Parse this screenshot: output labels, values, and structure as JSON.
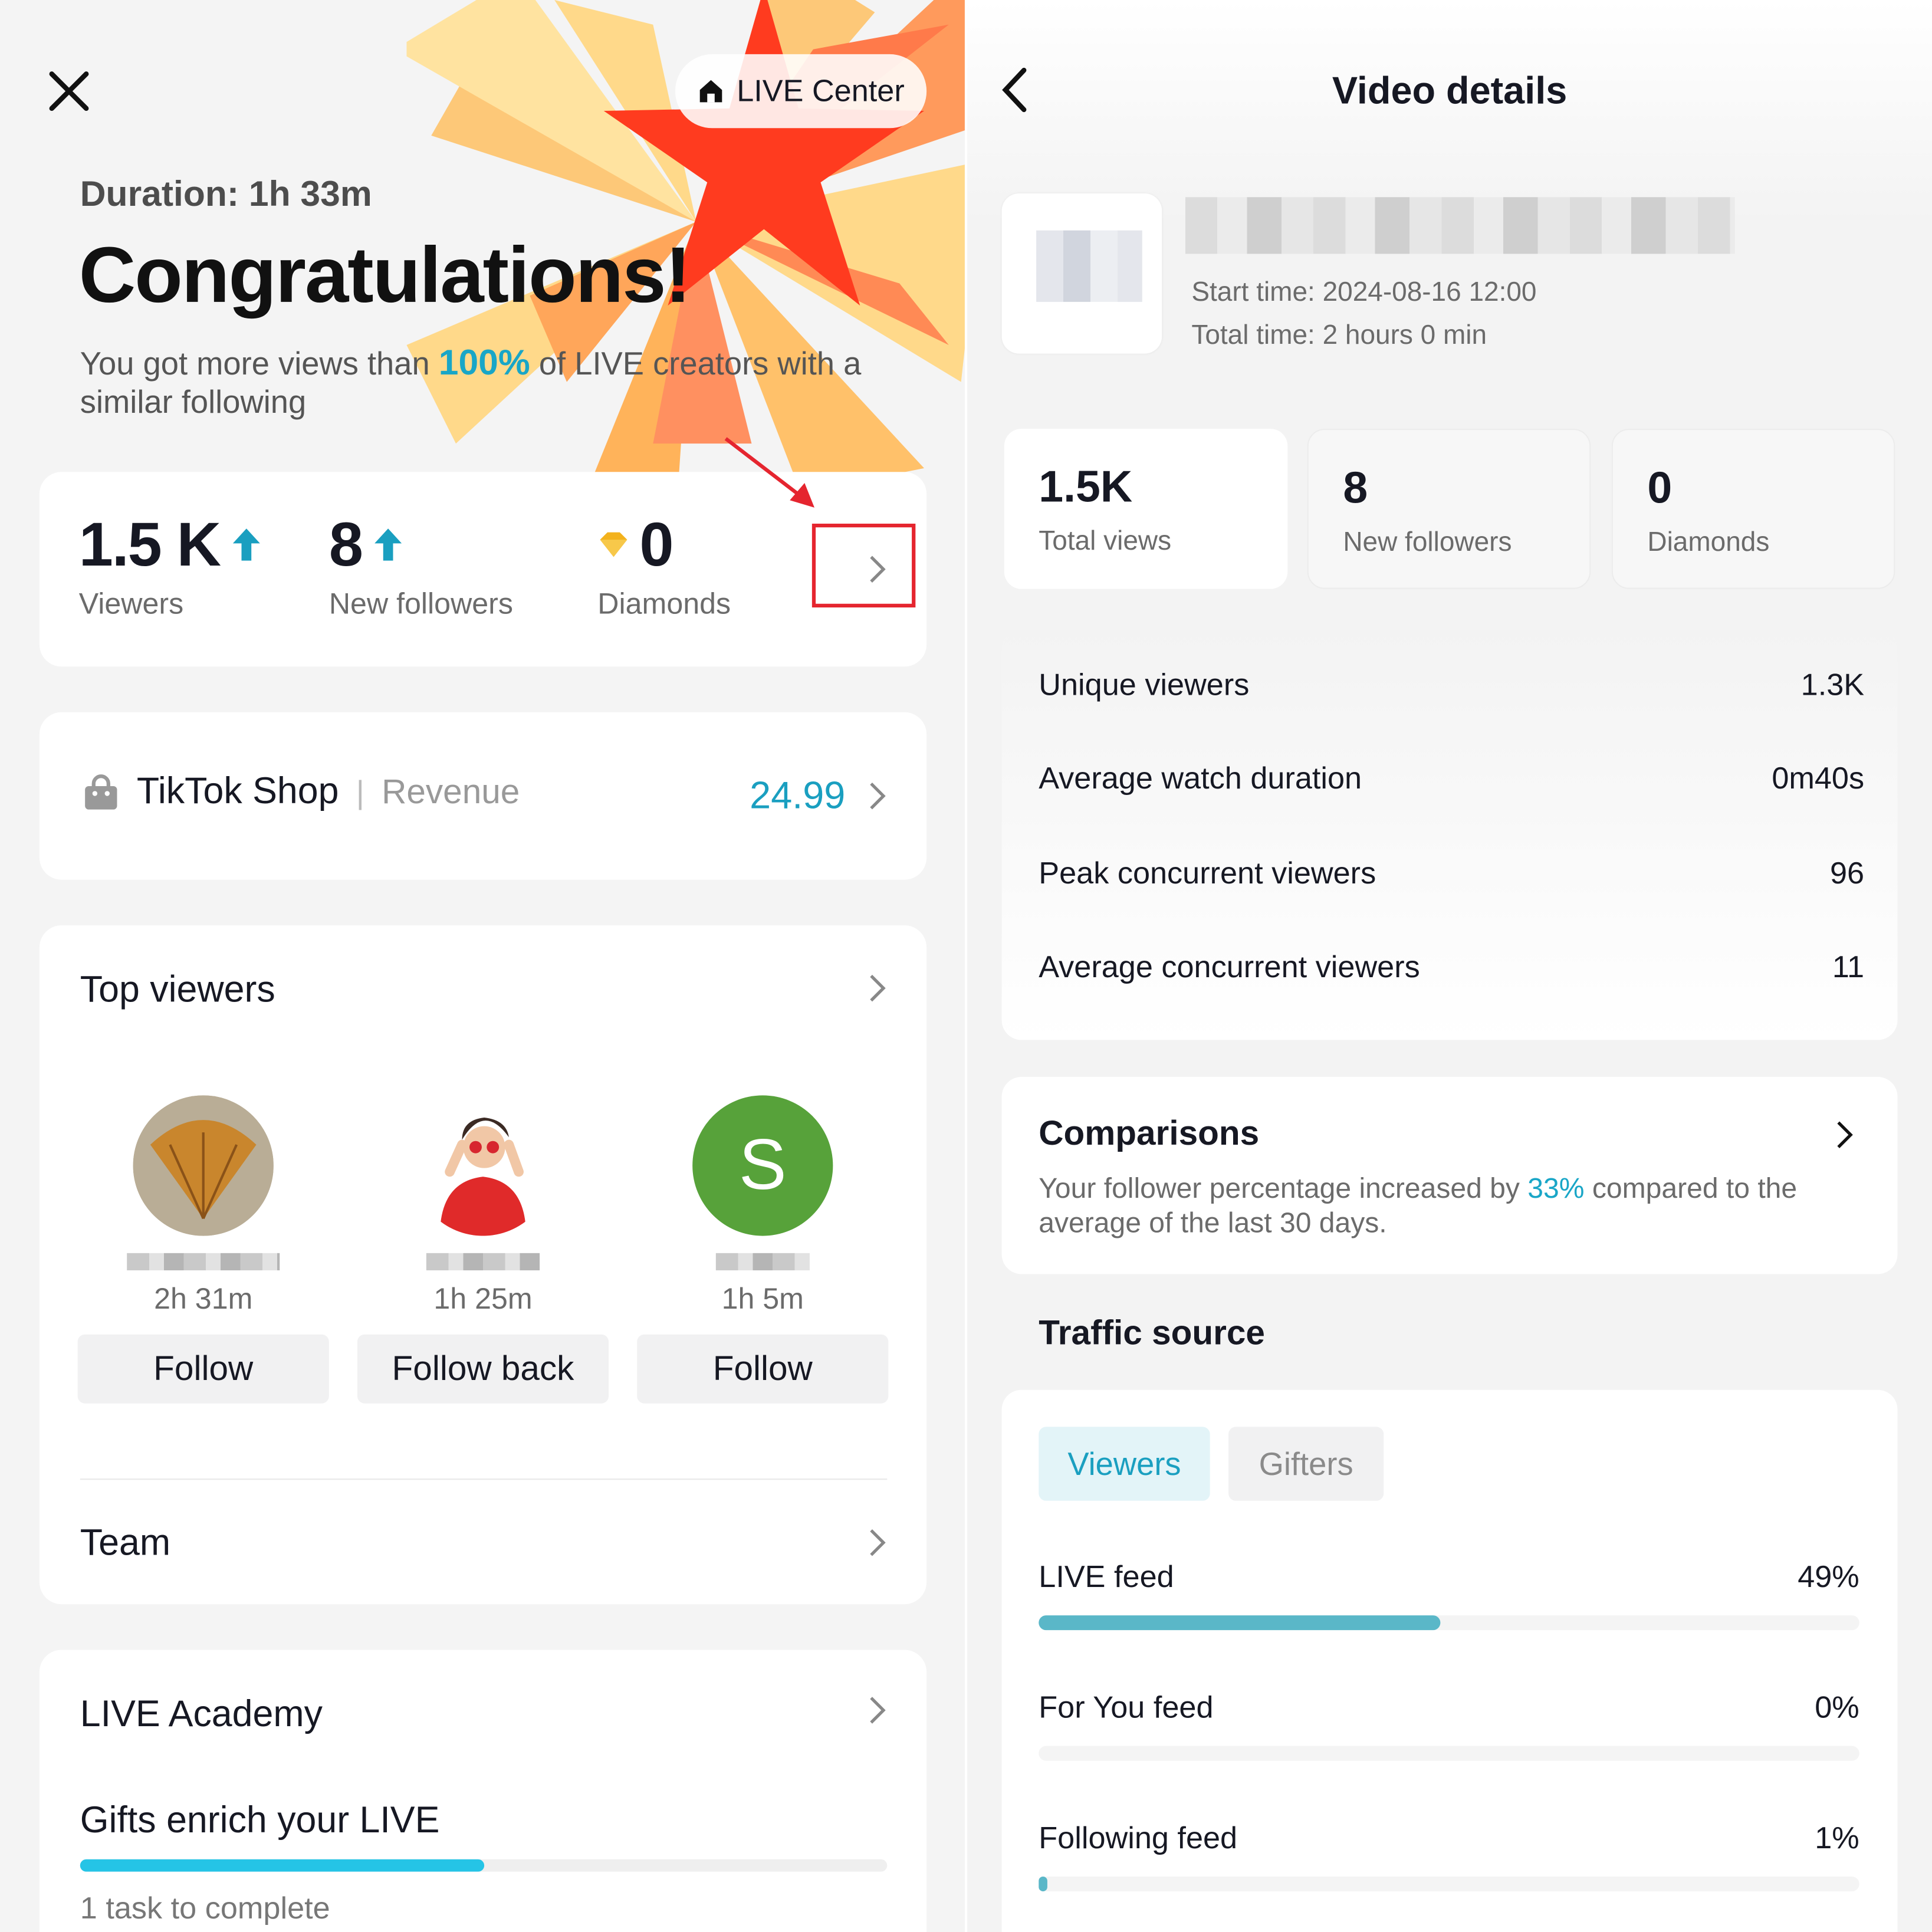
{
  "left": {
    "live_center_label": "LIVE Center",
    "duration": "Duration: 1h 33m",
    "headline": "Congratulations!",
    "views_prefix": "You got more views than ",
    "views_pct": "100%",
    "views_suffix": " of LIVE creators with a similar following",
    "stats": [
      {
        "value": "1.5 K",
        "label": "Viewers",
        "trend": "up"
      },
      {
        "value": "8",
        "label": "New followers",
        "trend": "up"
      },
      {
        "value": "0",
        "label": "Diamonds",
        "trend": "none"
      }
    ],
    "shop": {
      "title": "TikTok Shop",
      "separator": "|",
      "sub": "Revenue",
      "value": "24.99"
    },
    "top_viewers": {
      "title": "Top viewers",
      "viewers": [
        {
          "time": "2h 31m",
          "button": "Follow"
        },
        {
          "time": "1h 25m",
          "button": "Follow back"
        },
        {
          "time": "1h 5m",
          "button": "Follow",
          "initial": "S"
        }
      ]
    },
    "team_title": "Team",
    "academy": {
      "title": "LIVE Academy",
      "task": "Gifts enrich your LIVE",
      "progress": 0.5,
      "remaining": "1 task to complete"
    }
  },
  "right": {
    "title": "Video details",
    "start_time": "Start time: 2024-08-16 12:00",
    "total_time": "Total time: 2 hours 0 min",
    "summary": [
      {
        "value": "1.5K",
        "label": "Total views"
      },
      {
        "value": "8",
        "label": "New followers"
      },
      {
        "value": "0",
        "label": "Diamonds"
      }
    ],
    "metrics": [
      {
        "label": "Unique viewers",
        "value": "1.3K"
      },
      {
        "label": "Average watch duration",
        "value": "0m40s"
      },
      {
        "label": "Peak concurrent viewers",
        "value": "96"
      },
      {
        "label": "Average concurrent viewers",
        "value": "11"
      }
    ],
    "comparisons": {
      "title": "Comparisons",
      "text_prefix": "Your follower percentage increased by ",
      "pct": "33%",
      "text_suffix": " compared to the average of the last 30 days."
    },
    "traffic": {
      "title": "Traffic source",
      "tabs": [
        "Viewers",
        "Gifters"
      ],
      "active_tab": "Viewers",
      "sources": [
        {
          "label": "LIVE feed",
          "value": "49%",
          "fraction": 0.49
        },
        {
          "label": "For You feed",
          "value": "0%",
          "fraction": 0.0
        },
        {
          "label": "Following feed",
          "value": "1%",
          "fraction": 0.01
        }
      ]
    }
  },
  "colors": {
    "accent": "#19a6c7",
    "highlight": "#e5252f",
    "progress": "#25c4e6",
    "viewer_s_avatar": "#57a23a"
  },
  "icons": [
    "close-icon",
    "home-icon",
    "arrow-up-icon",
    "diamond-icon",
    "chevron-right-icon",
    "shopping-bag-icon",
    "back-icon"
  ]
}
